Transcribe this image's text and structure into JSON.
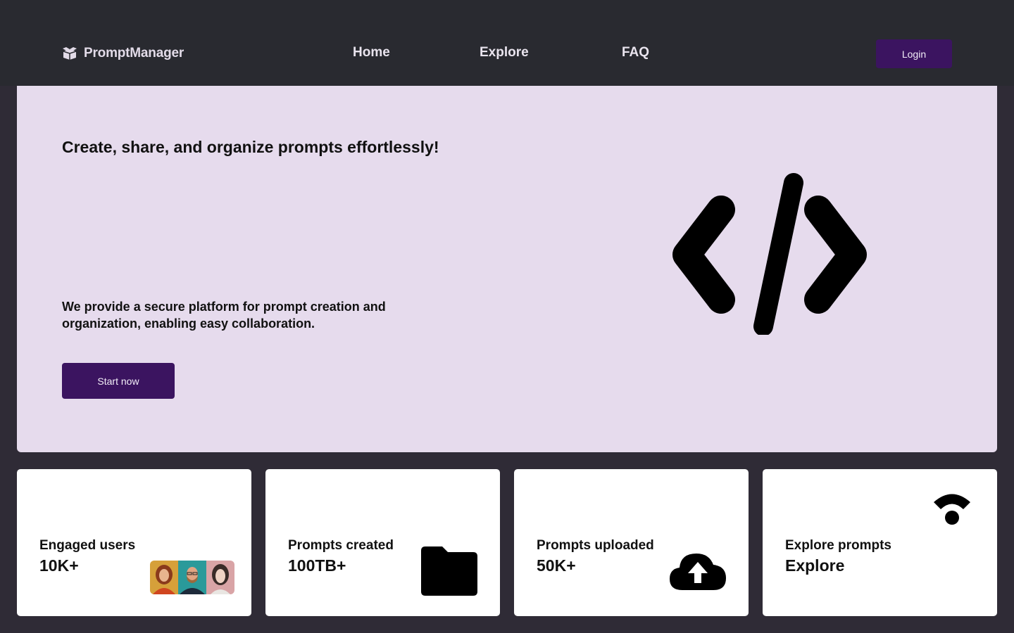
{
  "header": {
    "brand": "PromptManager",
    "nav": [
      {
        "label": "Home"
      },
      {
        "label": "Explore"
      },
      {
        "label": "FAQ"
      }
    ],
    "login_label": "Login"
  },
  "hero": {
    "title": "Create, share, and organize prompts effortlessly!",
    "description": "We provide a secure platform for prompt creation and organization, enabling easy collaboration.",
    "cta_label": "Start now",
    "illustration": "code-icon"
  },
  "stats": [
    {
      "label": "Engaged users",
      "value": "10K+",
      "icon": "avatars-image"
    },
    {
      "label": "Prompts created",
      "value": "100TB+",
      "icon": "folder-icon"
    },
    {
      "label": "Prompts uploaded",
      "value": "50K+",
      "icon": "cloud-upload-icon"
    },
    {
      "label": "Explore prompts",
      "value": "Explore",
      "icon": "wifi-icon"
    }
  ],
  "colors": {
    "navbar": "#292a30",
    "page_background": "#2f2b36",
    "hero_background": "#e6dbed",
    "primary_button": "#3b1460",
    "card_background": "#ffffff"
  }
}
